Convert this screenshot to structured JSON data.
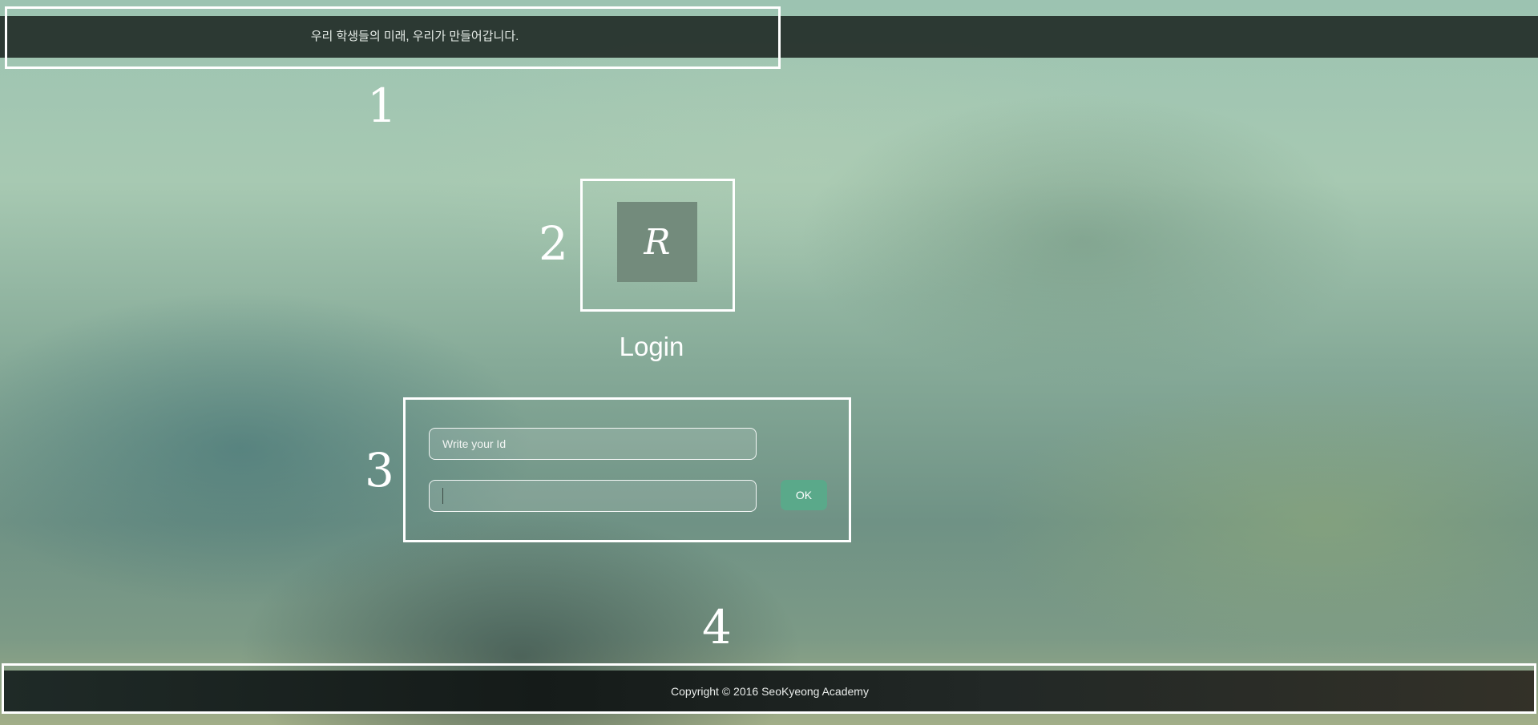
{
  "header": {
    "slogan": "우리 학생들의 미래, 우리가 만들어갑니다."
  },
  "logo": {
    "letter": "R"
  },
  "login": {
    "title": "Login",
    "id_placeholder": "Write your Id",
    "password_value": "",
    "ok_label": "OK"
  },
  "footer": {
    "copyright": "Copyright © 2016 SeoKyeong Academy"
  },
  "annotations": [
    "1",
    "2",
    "3",
    "4"
  ],
  "colors": {
    "bar": "#25302a",
    "accent_button": "#5aa98a",
    "logo_tile": "#738b7c"
  }
}
